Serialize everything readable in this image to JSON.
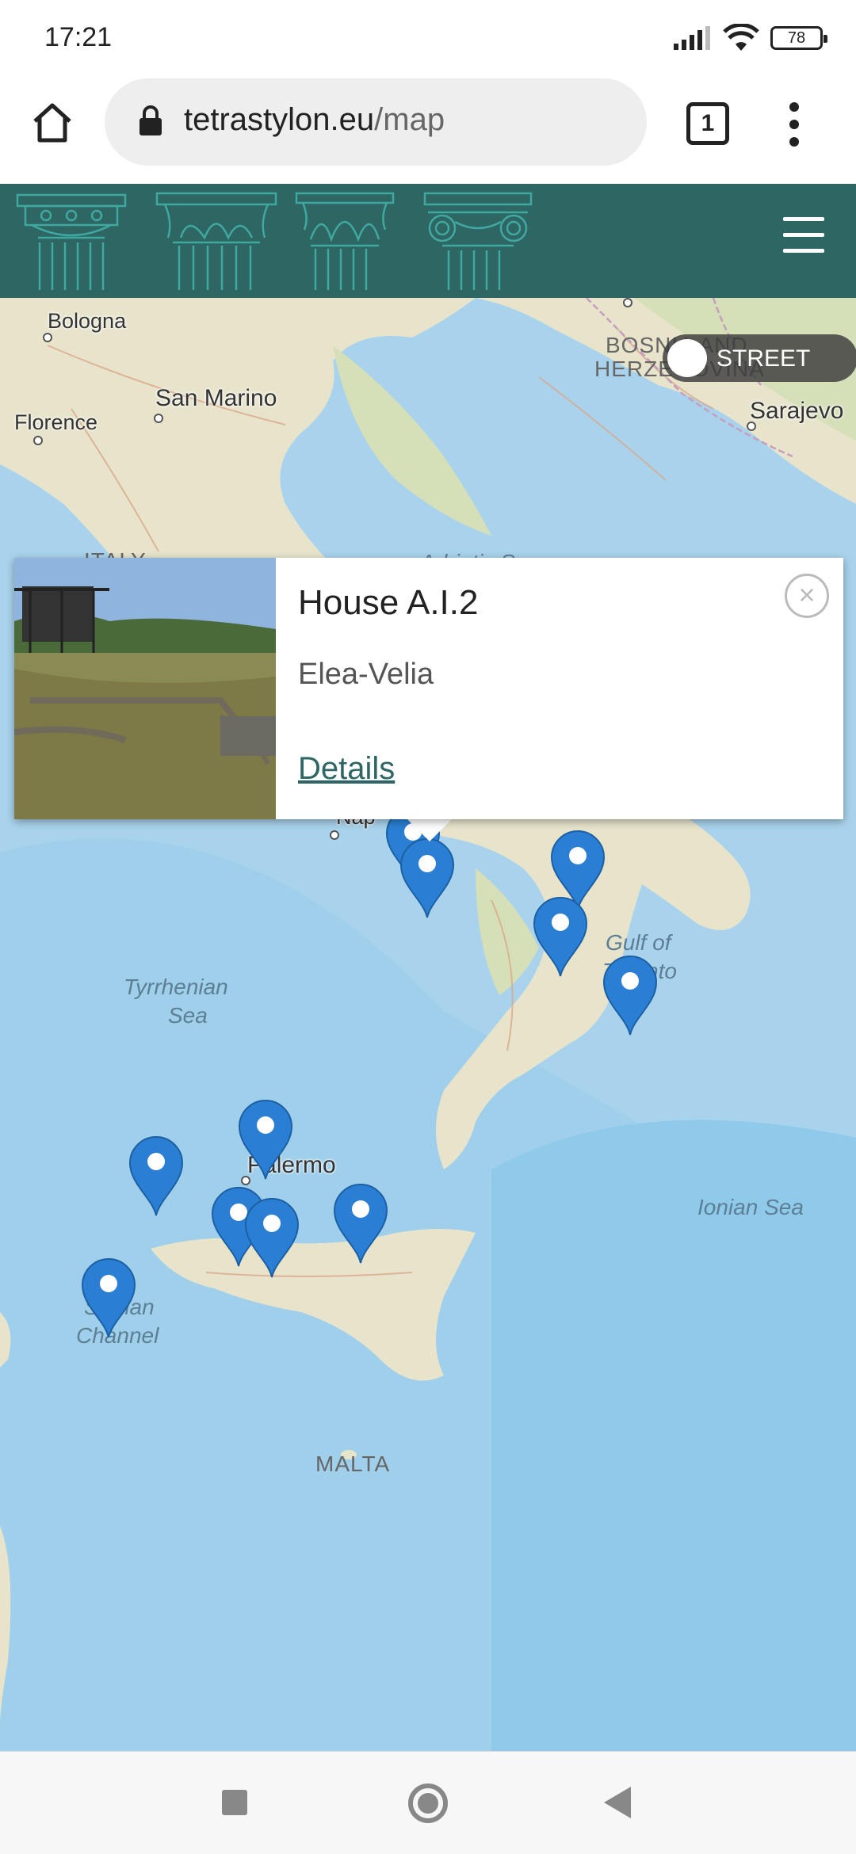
{
  "status_bar": {
    "time": "17:21",
    "battery": "78"
  },
  "browser": {
    "url_domain": "tetrastylon.eu",
    "url_path": "/map",
    "tab_count": "1"
  },
  "map": {
    "layer_toggle_label": "STREET",
    "labels": {
      "bologna": "Bologna",
      "san_marino": "San Marino",
      "florence": "Florence",
      "bosnia": "BOSNIA AND",
      "herzegovina": "HERZEGOVINA",
      "sarajevo": "Sarajevo",
      "italy": "ITALY",
      "adriatic": "Adriatic Sea",
      "naples": "Nap",
      "gulf_taranto_1": "Gulf of",
      "gulf_taranto_2": "Taranto",
      "tyrrhenian_1": "Tyrrhenian",
      "tyrrhenian_2": "Sea",
      "palermo": "Palermo",
      "ionian": "Ionian Sea",
      "sicilian_1": "Sicilian",
      "sicilian_2": "Channel",
      "malta": "MALTA"
    },
    "marker_color": "#2a7fd4"
  },
  "popup": {
    "title": "House A.I.2",
    "subtitle": "Elea-Velia",
    "link": "Details",
    "close_symbol": "×"
  }
}
